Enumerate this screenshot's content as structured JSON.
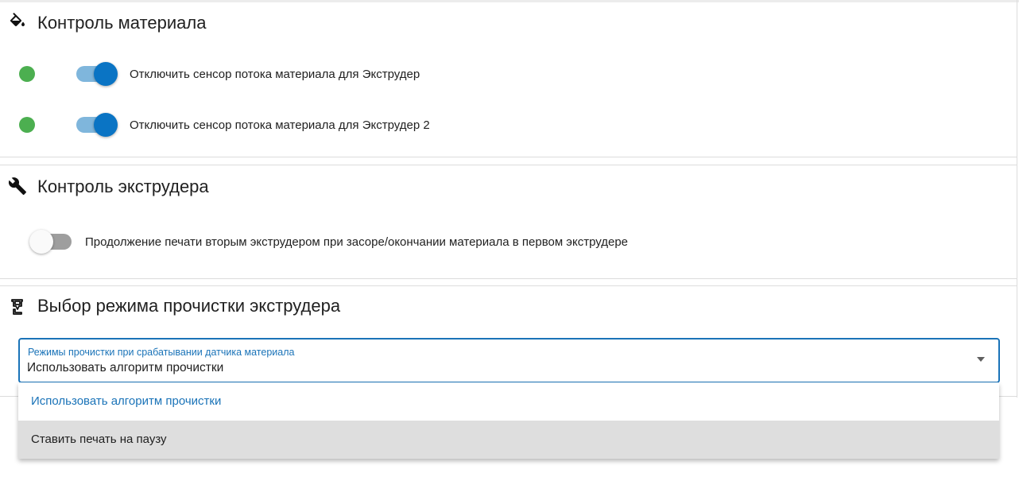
{
  "sections": {
    "material": {
      "title": "Контроль материала",
      "rows": [
        {
          "label": "Отключить сенсор потока материала для Экструдер",
          "status": "ok",
          "toggle": true
        },
        {
          "label": "Отключить сенсор потока материала для Экструдер 2",
          "status": "ok",
          "toggle": true
        }
      ]
    },
    "extruder": {
      "title": "Контроль экструдера",
      "rows": [
        {
          "label": "Продолжение печати вторым экструдером при засоре/окончании материала в первом экструдере",
          "toggle": false
        }
      ]
    },
    "cleaning": {
      "title": "Выбор режима прочистки экструдера",
      "select": {
        "label": "Режимы прочистки при срабатывании датчика материала",
        "value": "Использовать алгоритм прочистки",
        "options": [
          {
            "label": "Использовать алгоритм прочистки",
            "selected": true
          },
          {
            "label": "Ставить печать на паузу",
            "selected": false,
            "hovered": true
          }
        ]
      }
    }
  },
  "icons": {
    "material": "paint-bucket-icon",
    "extruder": "wrench-icon",
    "cleaning": "nozzle-icon"
  },
  "colors": {
    "accent": "#1a73b8",
    "switch_on_knob": "#0a74c4",
    "switch_on_track": "#7fb6dc",
    "status_ok": "#4caf50",
    "switch_off_track": "#9e9e9e",
    "hover_bg": "#dedede"
  }
}
